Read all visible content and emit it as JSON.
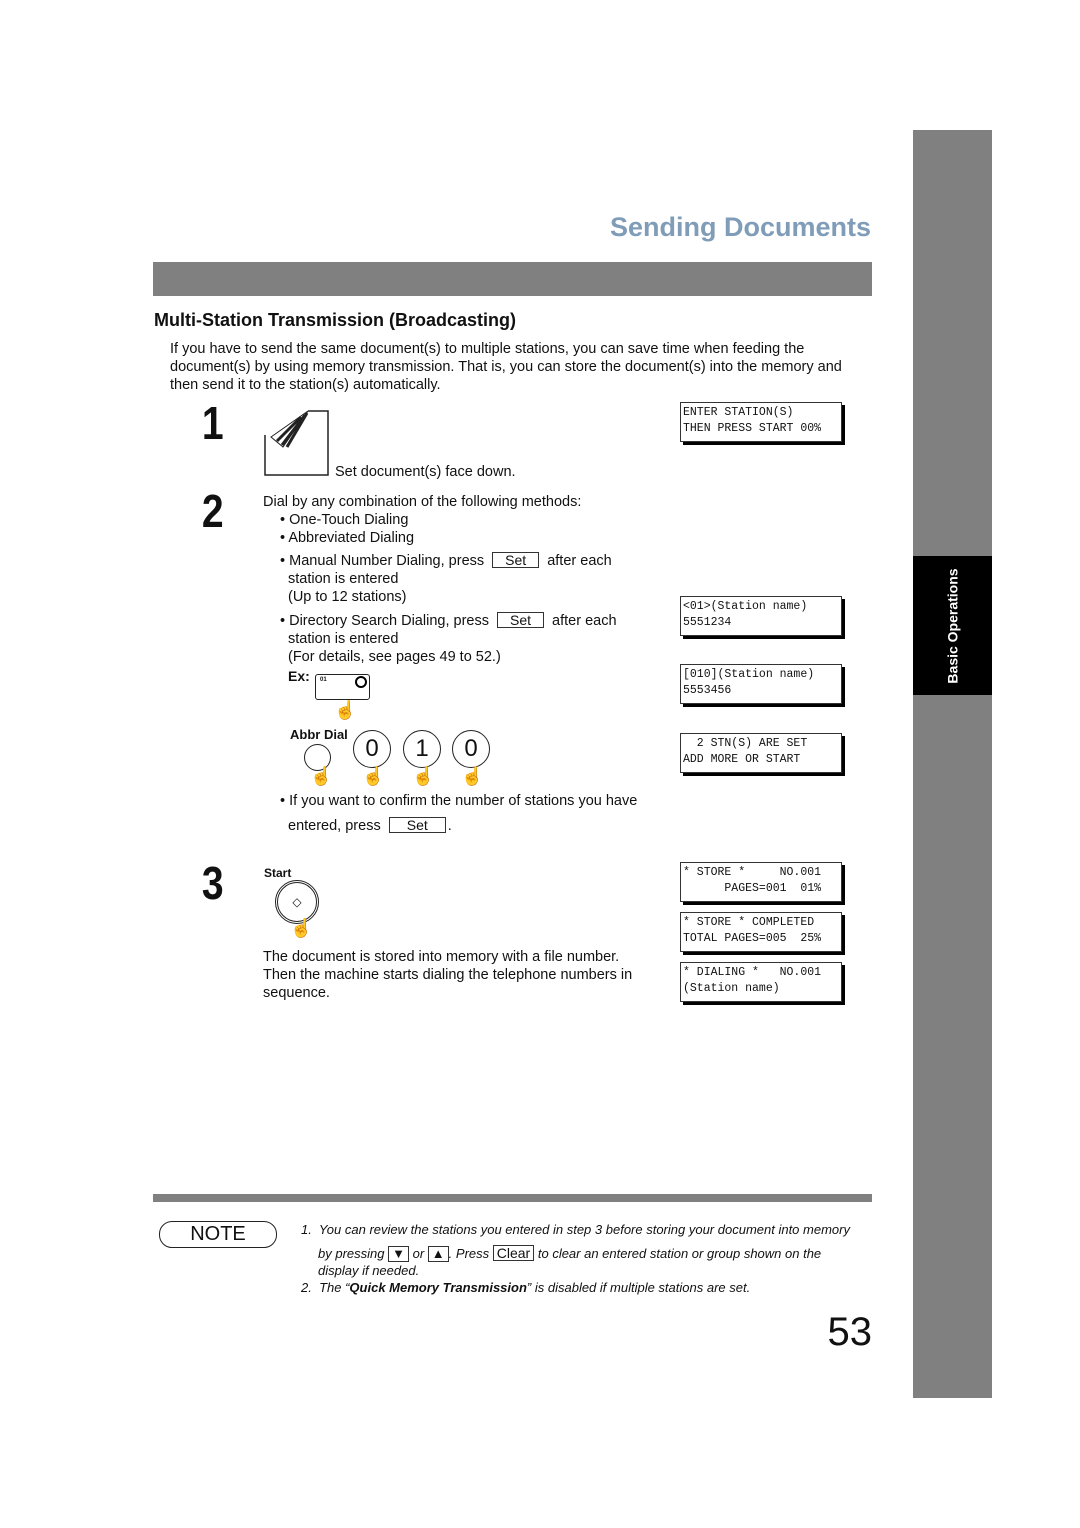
{
  "header": {
    "title": "Sending Documents"
  },
  "sidebar": {
    "section_label": "Basic Operations"
  },
  "section": {
    "heading": "Multi-Station Transmission (Broadcasting)",
    "intro": [
      "If you have to send the same document(s) to multiple stations, you can save time when feeding the",
      "document(s) by using memory transmission.  That is, you can store the document(s) into the memory and",
      "then send it to the station(s) automatically."
    ]
  },
  "steps": [
    {
      "number": "1",
      "text": "Set document(s) face down."
    },
    {
      "number": "2",
      "intro": "Dial by any combination of the following methods:",
      "bullets": [
        "One-Touch Dialing",
        "Abbreviated Dialing"
      ],
      "manual": {
        "text": "Manual Number Dialing, press",
        "key": "Set",
        "after": "after each",
        "line2": "station is entered",
        "line3": "(Up to 12 stations)"
      },
      "directory": {
        "text": "Directory Search Dialing, press",
        "key": "Set",
        "after": "after each",
        "line2": "station is entered",
        "line3": "(For details, see pages 49 to 52.)"
      },
      "example_label": "Ex:",
      "onetouch_key": "01",
      "abbr_label": "Abbr Dial",
      "abbr_digits": [
        "0",
        "1",
        "0"
      ],
      "confirm": {
        "line1": "If you want to confirm the number of stations you have",
        "line2": "entered, press",
        "key": "Set",
        "end": "."
      }
    },
    {
      "number": "3",
      "button_label": "Start",
      "text": [
        "The document is stored into memory with a file number.",
        "Then the machine starts dialing the telephone numbers in",
        "sequence."
      ]
    }
  ],
  "displays": [
    [
      "ENTER STATION(S)",
      "THEN PRESS START 00%"
    ],
    [
      "<01>(Station name)",
      "5551234"
    ],
    [
      "[010](Station name)",
      "5553456"
    ],
    [
      "  2 STN(S) ARE SET",
      "ADD MORE OR START"
    ],
    [
      "* STORE *     NO.001",
      "      PAGES=001  01%"
    ],
    [
      "* STORE * COMPLETED",
      "TOTAL PAGES=005  25%"
    ],
    [
      "* DIALING *   NO.001",
      "(Station name)"
    ]
  ],
  "note": {
    "label": "NOTE",
    "item1": {
      "num": "1.",
      "a": "You can review the stations you entered in step 3 before storing your document into memory",
      "b": "by pressing",
      "down": "▼",
      "or": "or",
      "up": "▲",
      "c": ". Press",
      "clear": "Clear",
      "d": "to clear an entered station or group shown on the",
      "e": "display if needed."
    },
    "item2": {
      "num": "2.",
      "a": "The “",
      "bold": "Quick Memory Transmission",
      "b": "” is disabled if multiple stations are set."
    }
  },
  "page_number": "53"
}
